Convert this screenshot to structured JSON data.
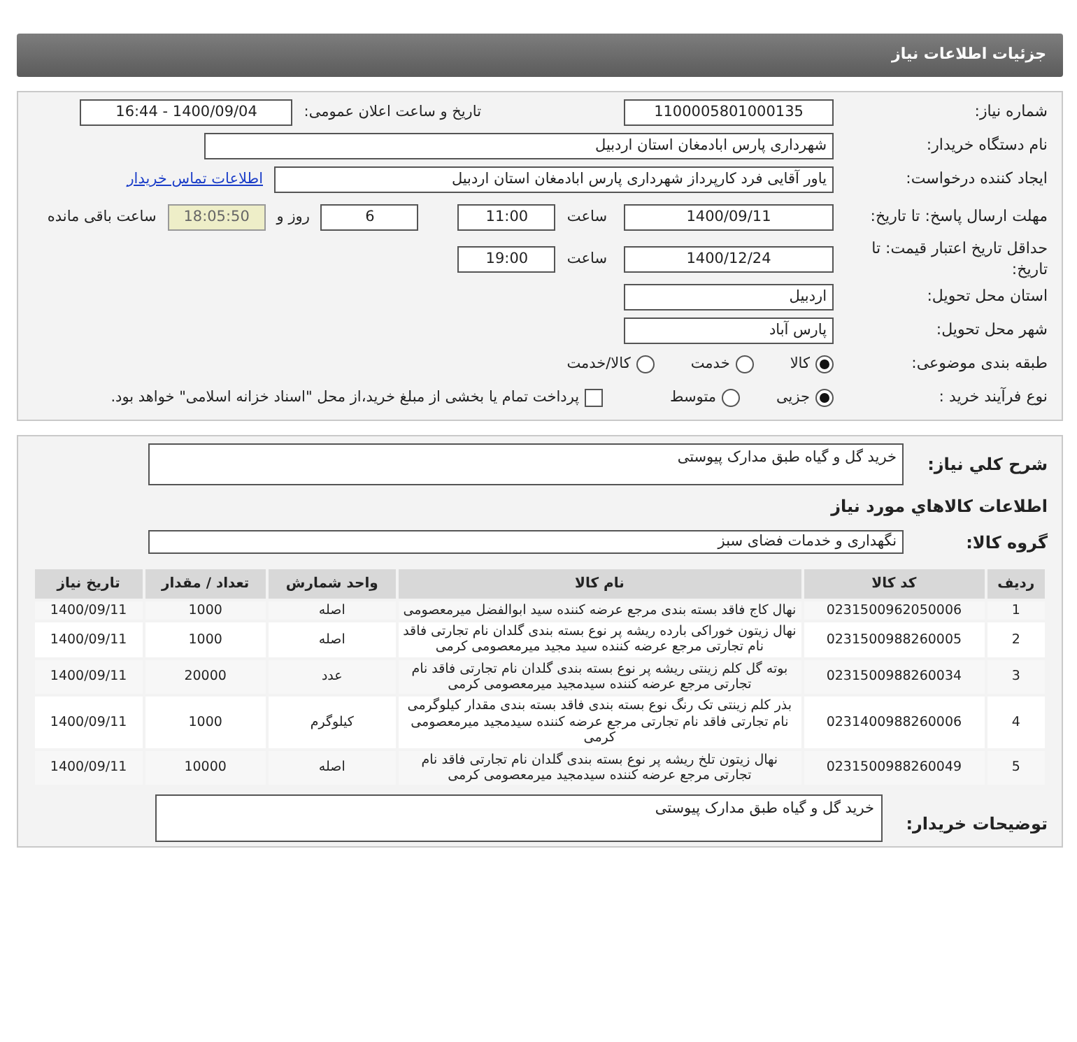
{
  "header": {
    "title": "جزئیات اطلاعات نیاز"
  },
  "need_number": {
    "label": "شماره نیاز:",
    "value": "1100005801000135"
  },
  "announce": {
    "label": "تاریخ و ساعت اعلان عمومی:",
    "value": "1400/09/04 - 16:44"
  },
  "buyer_org": {
    "label": "نام دستگاه خریدار:",
    "value": "شهرداری پارس ابادمغان استان اردبیل"
  },
  "requester": {
    "label": "ایجاد کننده درخواست:",
    "value": "یاور آقایی فرد کارپرداز شهرداری پارس ابادمغان استان اردبیل",
    "link": "اطلاعات تماس خریدار"
  },
  "deadline": {
    "label": "مهلت ارسال پاسخ: تا تاریخ:",
    "date": "1400/09/11",
    "time_label": "ساعت",
    "time": "11:00",
    "days": "6",
    "days_label": "روز و",
    "remaining": "18:05:50",
    "remaining_label": "ساعت باقی مانده"
  },
  "validity": {
    "label": "حداقل تاریخ اعتبار قیمت: تا تاریخ:",
    "date": "1400/12/24",
    "time_label": "ساعت",
    "time": "19:00"
  },
  "province": {
    "label": "استان محل تحویل:",
    "value": "اردبیل"
  },
  "city": {
    "label": "شهر محل تحویل:",
    "value": "پارس آباد"
  },
  "category": {
    "label": "طبقه بندی موضوعی:",
    "options": [
      {
        "label": "کالا",
        "selected": true
      },
      {
        "label": "خدمت",
        "selected": false
      },
      {
        "label": "کالا/خدمت",
        "selected": false
      }
    ]
  },
  "process": {
    "label": "نوع فرآیند خرید :",
    "options": [
      {
        "label": "جزیی",
        "selected": true
      },
      {
        "label": "متوسط",
        "selected": false
      }
    ],
    "payment": {
      "label": "پرداخت تمام یا بخشی از مبلغ خرید،از محل \"اسناد خزانه اسلامی\" خواهد بود.",
      "checked": false
    }
  },
  "summary": {
    "label": "شرح کلي نياز:",
    "value": "خريد گل و گیاه طبق مدارک پیوستی"
  },
  "goods_title": "اطلاعات کالاهاي مورد نياز",
  "goods_group": {
    "label": "گروه کالا:",
    "value": "نگهداری و خدمات فضای سبز"
  },
  "table": {
    "columns": [
      "رديف",
      "کد کالا",
      "نام کالا",
      "واحد شمارش",
      "تعداد / مقدار",
      "تاریخ نیاز"
    ],
    "rows": [
      [
        "1",
        "0231500962050006",
        "نهال کاج فاقد بسته بندی مرجع عرضه کننده سید ابوالفضل میرمعصومی",
        "اصله",
        "1000",
        "1400/09/11"
      ],
      [
        "2",
        "0231500988260005",
        "نهال زیتون خوراکی بارده ریشه پر نوع بسته بندی گلدان نام تجارتی فاقد نام تجارتی مرجع عرضه کننده سید مجید میرمعصومی کرمی",
        "اصله",
        "1000",
        "1400/09/11"
      ],
      [
        "3",
        "0231500988260034",
        "بوته گل کلم زینتی ریشه پر نوع بسته بندی گلدان نام تجارتی فاقد نام تجارتی مرجع عرضه کننده سیدمجید میرمعصومی کرمی",
        "عدد",
        "20000",
        "1400/09/11"
      ],
      [
        "4",
        "0231400988260006",
        "بذر کلم زینتی تک رنگ نوع بسته بندی فاقد بسته بندی مقدار کیلوگرمی نام تجارتی فاقد نام تجارتی مرجع عرضه کننده سیدمجید میرمعصومی کرمی",
        "کیلوگرم",
        "1000",
        "1400/09/11"
      ],
      [
        "5",
        "0231500988260049",
        "نهال زیتون تلخ ریشه پر نوع بسته بندی گلدان نام تجارتی فاقد نام تجارتی مرجع عرضه کننده سیدمجید میرمعصومی کرمی",
        "اصله",
        "10000",
        "1400/09/11"
      ]
    ]
  },
  "buyer_notes": {
    "label": "توضیحات خریدار:",
    "value": "خريد گل و گیاه طبق مدارک پیوستی"
  }
}
